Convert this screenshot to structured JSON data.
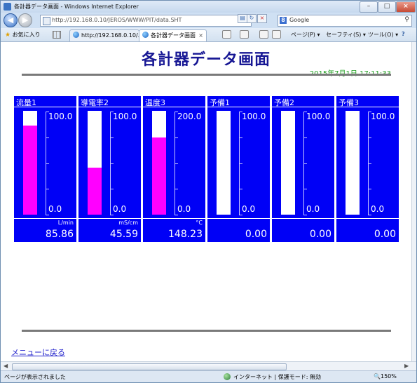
{
  "window": {
    "title": "各計器データ画面 - Windows Internet Explorer"
  },
  "address_bar": {
    "url": "http://192.168.0.10/JEROS/WWW/PIT/data.SHT"
  },
  "search": {
    "provider": "Google"
  },
  "favorites_bar": {
    "favorites_label": "お気に入り"
  },
  "tabs": [
    {
      "label": "http://192.168.0.10/..."
    },
    {
      "label": "各計器データ画面"
    }
  ],
  "command_bar": {
    "page_menu": "ページ(P) ▾",
    "safety_menu": "セーフティ(S) ▾",
    "tools_menu": "ツール(O) ▾"
  },
  "page": {
    "title": "各計器データ画面",
    "timestamp": "2015年7月1日 17:11:33",
    "menu_link": "メニューに戻る"
  },
  "meters": [
    {
      "label": "流量1",
      "max": "100.0",
      "min": "0.0",
      "unit": "L/min",
      "value": "85.86",
      "fill_fraction": 0.8586
    },
    {
      "label": "導電率2",
      "max": "100.0",
      "min": "0.0",
      "unit": "mS/cm",
      "value": "45.59",
      "fill_fraction": 0.4559
    },
    {
      "label": "温度3",
      "max": "200.0",
      "min": "0.0",
      "unit": "°C",
      "value": "148.23",
      "fill_fraction": 0.74115
    },
    {
      "label": "予備1",
      "max": "100.0",
      "min": "0.0",
      "unit": "",
      "value": "0.00",
      "fill_fraction": 0
    },
    {
      "label": "予備2",
      "max": "100.0",
      "min": "0.0",
      "unit": "",
      "value": "0.00",
      "fill_fraction": 0
    },
    {
      "label": "予備3",
      "max": "100.0",
      "min": "0.0",
      "unit": "",
      "value": "0.00",
      "fill_fraction": 0
    }
  ],
  "status_bar": {
    "left_text": "ページが表示されました",
    "zone_text": "インターネット | 保護モード: 無効",
    "zoom": "150%"
  },
  "colors": {
    "panel_bg": "#0000f6",
    "bar_fill": "#ff00ff",
    "title_color": "#171794",
    "timestamp_color": "#22a022"
  }
}
